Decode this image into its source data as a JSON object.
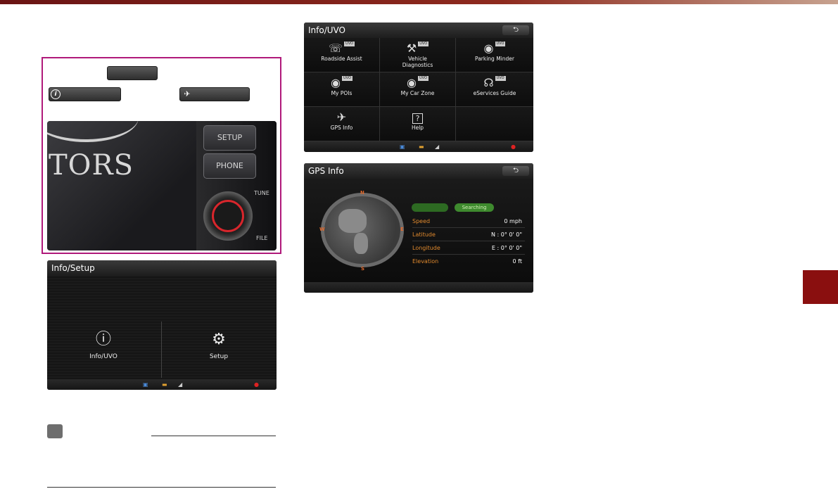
{
  "colors": {
    "accent_maroon": "#8a0f0f",
    "highlight_border": "#b0197a",
    "gps_label_orange": "#e0892d",
    "gps_pill_green": "#3e8a2e",
    "knob_red": "#d8262c"
  },
  "head_unit": {
    "logo_text": "TORS",
    "setup_label": "SETUP",
    "phone_label": "PHONE",
    "tune_label": "TUNE",
    "file_label": "FILE"
  },
  "info_setup_screen": {
    "title": "Info/Setup",
    "items": [
      {
        "label": "Info/UVO",
        "icon": "info-icon"
      },
      {
        "label": "Setup",
        "icon": "gear-icon"
      }
    ]
  },
  "uvo_screen": {
    "title": "Info/UVO",
    "back_icon": "back-arrow-icon",
    "badge": "UVO",
    "items": [
      {
        "label": "Roadside Assist",
        "icon": "roadside-icon",
        "uvo": true
      },
      {
        "label": "Vehicle Diagnostics",
        "icon": "diagnostics-icon",
        "uvo": true
      },
      {
        "label": "Parking Minder",
        "icon": "parking-icon",
        "uvo": true
      },
      {
        "label": "My POIs",
        "icon": "poi-icon",
        "uvo": true
      },
      {
        "label": "My Car Zone",
        "icon": "car-zone-icon",
        "uvo": true
      },
      {
        "label": "eServices Guide",
        "icon": "eservices-icon",
        "uvo": true
      },
      {
        "label": "GPS Info",
        "icon": "satellite-icon",
        "uvo": false
      },
      {
        "label": "Help",
        "icon": "help-icon",
        "uvo": false
      }
    ]
  },
  "gps_screen": {
    "title": "GPS Info",
    "back_icon": "back-arrow-icon",
    "compass": {
      "n": "N",
      "s": "S",
      "e": "E",
      "w": "W"
    },
    "status_pill": "Searching",
    "rows": [
      {
        "label": "Speed",
        "value": "0 mph"
      },
      {
        "label": "Latitude",
        "value": "N : 0° 0' 0\""
      },
      {
        "label": "Longitude",
        "value": "E : 0° 0' 0\""
      },
      {
        "label": "Elevation",
        "value": "0 ft"
      }
    ]
  }
}
